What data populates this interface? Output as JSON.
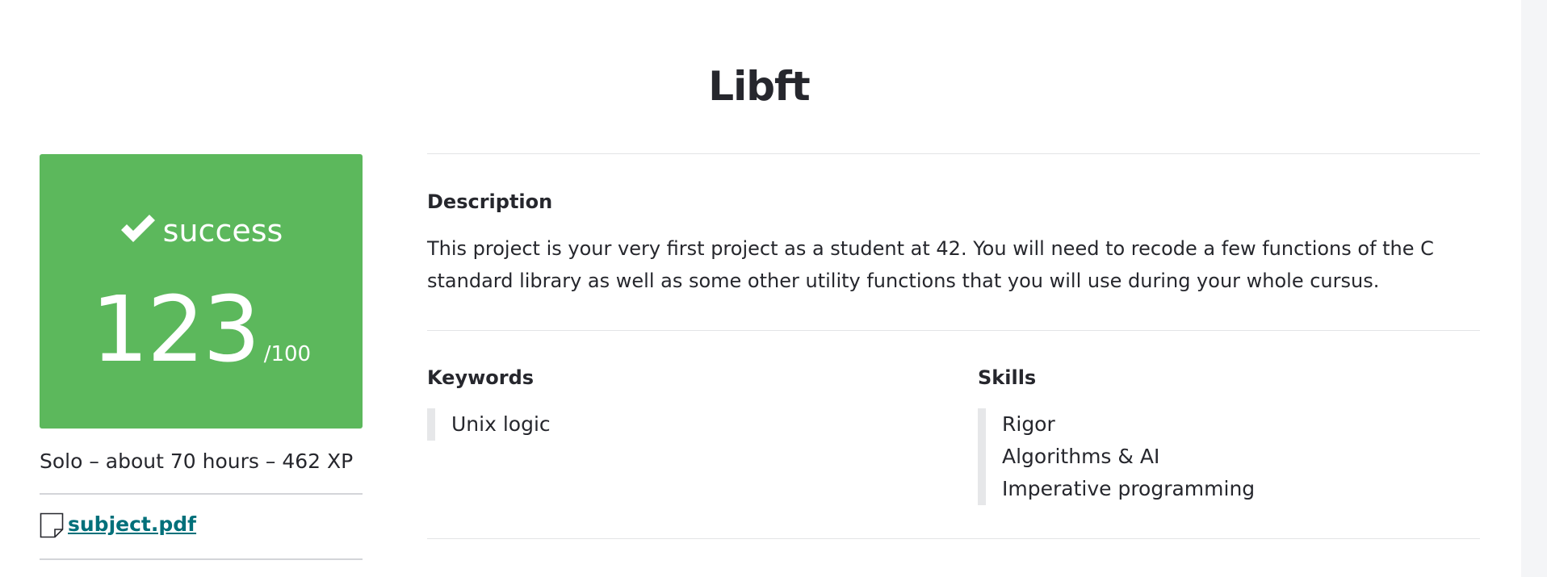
{
  "project": {
    "title": "Libft"
  },
  "status": {
    "label": "success",
    "score": "123",
    "score_max": "/100",
    "color": "#5cb85c"
  },
  "meta": {
    "summary": "Solo – about 70 hours – 462 XP"
  },
  "attachment": {
    "filename": "subject.pdf",
    "link_color": "#00707a"
  },
  "description": {
    "heading": "Description",
    "text": "This project is your very first project as a student at 42. You will need to recode a few functions of the C standard library as well as some other utility functions that you will use during your whole cursus."
  },
  "keywords": {
    "heading": "Keywords",
    "items": [
      "Unix logic"
    ]
  },
  "skills": {
    "heading": "Skills",
    "items": [
      "Rigor",
      "Algorithms & AI",
      "Imperative programming"
    ]
  },
  "icons": {
    "status": "check-icon",
    "attachment": "document-icon"
  }
}
